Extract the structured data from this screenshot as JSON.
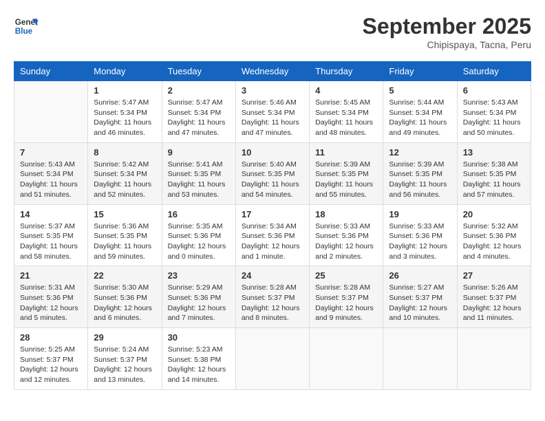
{
  "logo": {
    "line1": "General",
    "line2": "Blue"
  },
  "header": {
    "title": "September 2025",
    "subtitle": "Chipispaya, Tacna, Peru"
  },
  "weekdays": [
    "Sunday",
    "Monday",
    "Tuesday",
    "Wednesday",
    "Thursday",
    "Friday",
    "Saturday"
  ],
  "weeks": [
    [
      {
        "day": "",
        "info": ""
      },
      {
        "day": "1",
        "info": "Sunrise: 5:47 AM\nSunset: 5:34 PM\nDaylight: 11 hours\nand 46 minutes."
      },
      {
        "day": "2",
        "info": "Sunrise: 5:47 AM\nSunset: 5:34 PM\nDaylight: 11 hours\nand 47 minutes."
      },
      {
        "day": "3",
        "info": "Sunrise: 5:46 AM\nSunset: 5:34 PM\nDaylight: 11 hours\nand 47 minutes."
      },
      {
        "day": "4",
        "info": "Sunrise: 5:45 AM\nSunset: 5:34 PM\nDaylight: 11 hours\nand 48 minutes."
      },
      {
        "day": "5",
        "info": "Sunrise: 5:44 AM\nSunset: 5:34 PM\nDaylight: 11 hours\nand 49 minutes."
      },
      {
        "day": "6",
        "info": "Sunrise: 5:43 AM\nSunset: 5:34 PM\nDaylight: 11 hours\nand 50 minutes."
      }
    ],
    [
      {
        "day": "7",
        "info": "Sunrise: 5:43 AM\nSunset: 5:34 PM\nDaylight: 11 hours\nand 51 minutes."
      },
      {
        "day": "8",
        "info": "Sunrise: 5:42 AM\nSunset: 5:34 PM\nDaylight: 11 hours\nand 52 minutes."
      },
      {
        "day": "9",
        "info": "Sunrise: 5:41 AM\nSunset: 5:35 PM\nDaylight: 11 hours\nand 53 minutes."
      },
      {
        "day": "10",
        "info": "Sunrise: 5:40 AM\nSunset: 5:35 PM\nDaylight: 11 hours\nand 54 minutes."
      },
      {
        "day": "11",
        "info": "Sunrise: 5:39 AM\nSunset: 5:35 PM\nDaylight: 11 hours\nand 55 minutes."
      },
      {
        "day": "12",
        "info": "Sunrise: 5:39 AM\nSunset: 5:35 PM\nDaylight: 11 hours\nand 56 minutes."
      },
      {
        "day": "13",
        "info": "Sunrise: 5:38 AM\nSunset: 5:35 PM\nDaylight: 11 hours\nand 57 minutes."
      }
    ],
    [
      {
        "day": "14",
        "info": "Sunrise: 5:37 AM\nSunset: 5:35 PM\nDaylight: 11 hours\nand 58 minutes."
      },
      {
        "day": "15",
        "info": "Sunrise: 5:36 AM\nSunset: 5:35 PM\nDaylight: 11 hours\nand 59 minutes."
      },
      {
        "day": "16",
        "info": "Sunrise: 5:35 AM\nSunset: 5:36 PM\nDaylight: 12 hours\nand 0 minutes."
      },
      {
        "day": "17",
        "info": "Sunrise: 5:34 AM\nSunset: 5:36 PM\nDaylight: 12 hours\nand 1 minute."
      },
      {
        "day": "18",
        "info": "Sunrise: 5:33 AM\nSunset: 5:36 PM\nDaylight: 12 hours\nand 2 minutes."
      },
      {
        "day": "19",
        "info": "Sunrise: 5:33 AM\nSunset: 5:36 PM\nDaylight: 12 hours\nand 3 minutes."
      },
      {
        "day": "20",
        "info": "Sunrise: 5:32 AM\nSunset: 5:36 PM\nDaylight: 12 hours\nand 4 minutes."
      }
    ],
    [
      {
        "day": "21",
        "info": "Sunrise: 5:31 AM\nSunset: 5:36 PM\nDaylight: 12 hours\nand 5 minutes."
      },
      {
        "day": "22",
        "info": "Sunrise: 5:30 AM\nSunset: 5:36 PM\nDaylight: 12 hours\nand 6 minutes."
      },
      {
        "day": "23",
        "info": "Sunrise: 5:29 AM\nSunset: 5:36 PM\nDaylight: 12 hours\nand 7 minutes."
      },
      {
        "day": "24",
        "info": "Sunrise: 5:28 AM\nSunset: 5:37 PM\nDaylight: 12 hours\nand 8 minutes."
      },
      {
        "day": "25",
        "info": "Sunrise: 5:28 AM\nSunset: 5:37 PM\nDaylight: 12 hours\nand 9 minutes."
      },
      {
        "day": "26",
        "info": "Sunrise: 5:27 AM\nSunset: 5:37 PM\nDaylight: 12 hours\nand 10 minutes."
      },
      {
        "day": "27",
        "info": "Sunrise: 5:26 AM\nSunset: 5:37 PM\nDaylight: 12 hours\nand 11 minutes."
      }
    ],
    [
      {
        "day": "28",
        "info": "Sunrise: 5:25 AM\nSunset: 5:37 PM\nDaylight: 12 hours\nand 12 minutes."
      },
      {
        "day": "29",
        "info": "Sunrise: 5:24 AM\nSunset: 5:37 PM\nDaylight: 12 hours\nand 13 minutes."
      },
      {
        "day": "30",
        "info": "Sunrise: 5:23 AM\nSunset: 5:38 PM\nDaylight: 12 hours\nand 14 minutes."
      },
      {
        "day": "",
        "info": ""
      },
      {
        "day": "",
        "info": ""
      },
      {
        "day": "",
        "info": ""
      },
      {
        "day": "",
        "info": ""
      }
    ]
  ]
}
